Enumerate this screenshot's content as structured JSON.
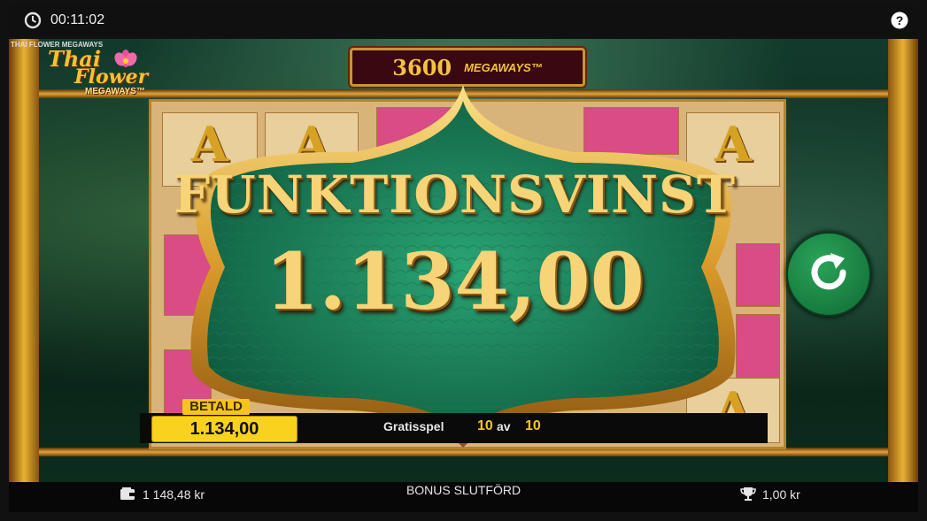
{
  "topbar": {
    "time": "00:11:02",
    "clock_icon": "clock-icon",
    "help_icon": "help-icon"
  },
  "game": {
    "name_small": "THAI FLOWER MEGAWAYS",
    "logo_line1": "Thai",
    "logo_line2": "Flower",
    "logo_line3": "MEGAWAYS™",
    "ways_count": "3600",
    "ways_label": "MEGAWAYS™"
  },
  "reels": {
    "letter_symbol": "A"
  },
  "popup": {
    "title": "FUNKTIONSVINST",
    "amount": "1.134,00"
  },
  "spin": {
    "icon": "replay-icon"
  },
  "win_panel": {
    "label": "BETALD",
    "value": "1.134,00"
  },
  "free_spins": {
    "label": "Gratisspel",
    "current": "10",
    "of": "av",
    "total": "10"
  },
  "bottombar": {
    "balance": "1 148,48 kr",
    "status": "BONUS SLUTFÖRD",
    "bet": "1,00 kr",
    "wallet_icon": "wallet-icon",
    "trophy_icon": "trophy-icon"
  },
  "colors": {
    "gold": "#f6d477",
    "popup_green": "#1f8a62",
    "win_yellow": "#f8d21e"
  }
}
